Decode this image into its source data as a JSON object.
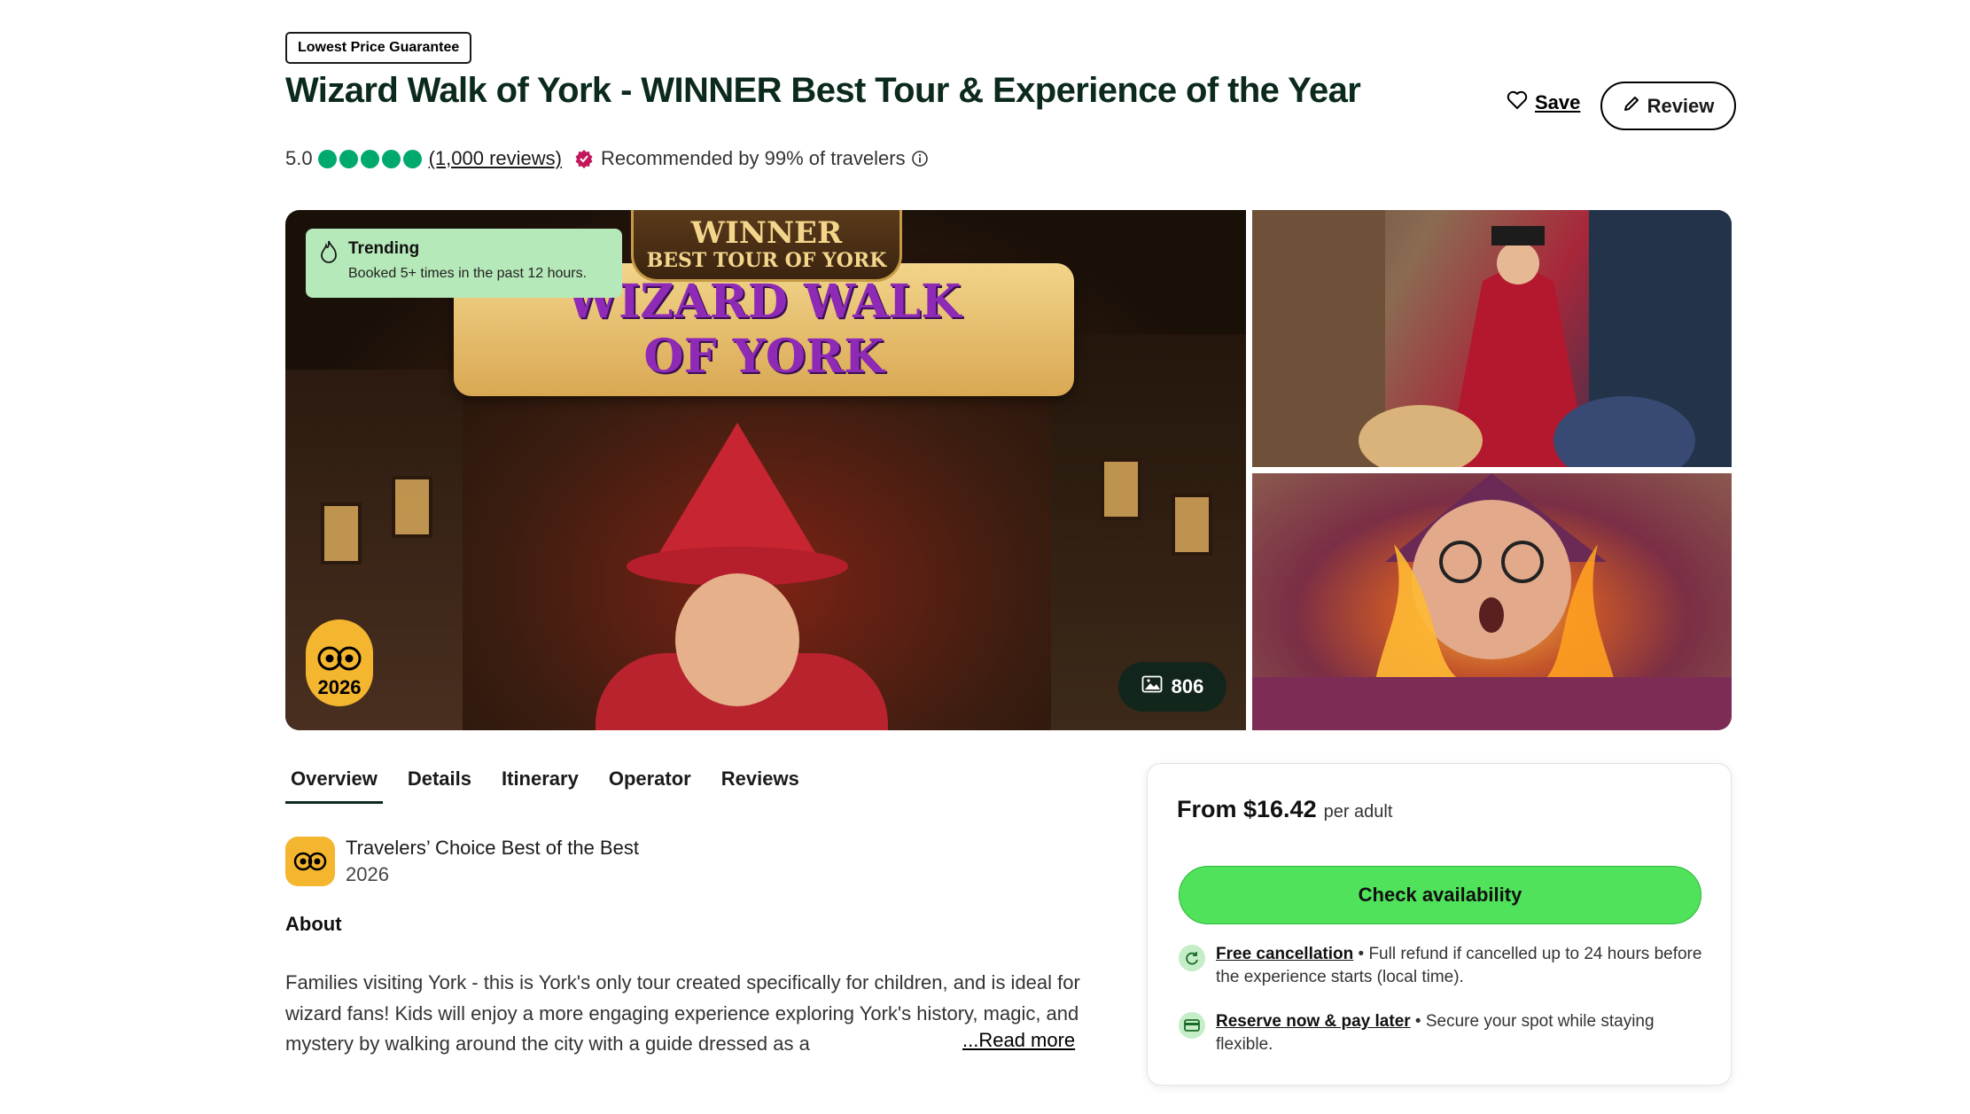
{
  "badge": {
    "lowest_price": "Lowest Price Guarantee"
  },
  "header": {
    "title": "Wizard Walk of York - WINNER Best Tour & Experience of the Year",
    "save_label": "Save",
    "review_label": "Review"
  },
  "rating": {
    "score": "5.0",
    "bubbles_filled": 5,
    "bubbles_total": 5,
    "reviews_text": "(1,000 reviews)",
    "recommended_text": "Recommended by 99% of travelers"
  },
  "gallery": {
    "trending_title": "Trending",
    "trending_text": "Booked 5+ times in the past 12 hours.",
    "award_year": "2026",
    "photo_count": "806",
    "winner_line1": "WINNER",
    "winner_line2": "BEST TOUR OF YORK",
    "sign_line1": "WIZARD WALK",
    "sign_line2": "OF YORK"
  },
  "tabs": [
    {
      "label": "Overview",
      "active": true
    },
    {
      "label": "Details",
      "active": false
    },
    {
      "label": "Itinerary",
      "active": false
    },
    {
      "label": "Operator",
      "active": false
    },
    {
      "label": "Reviews",
      "active": false
    }
  ],
  "travelers_choice": {
    "title": "Travelers’ Choice Best of the Best",
    "year": "2026"
  },
  "about": {
    "heading": "About",
    "text": "Families visiting York - this is York's only tour created specifically for children, and is ideal for wizard fans! Kids will enjoy a more engaging experience exploring York's history, magic, and mystery by walking around the city with a guide dressed as a",
    "read_more": "...Read more"
  },
  "booking": {
    "price_prefix": "From $16.42",
    "price_unit": "per adult",
    "check_label": "Check availability",
    "free_cancel_link": "Free cancellation",
    "free_cancel_text": " • Full refund if cancelled up to 24 hours before the experience starts (local time).",
    "reserve_link": "Reserve now & pay later",
    "reserve_text": " • Secure your spot while staying flexible."
  },
  "colors": {
    "brand_green": "#00aa6c",
    "cta_green": "#4fe25a",
    "trending_bg": "#b6e9b9",
    "award_yellow": "#f5b62f"
  },
  "icons": [
    "heart-icon",
    "pencil-icon",
    "rating-bubble-icon",
    "recommended-check-icon",
    "info-icon",
    "flame-icon",
    "tripadvisor-owl-icon",
    "photo-icon",
    "refresh-icon",
    "card-icon"
  ]
}
